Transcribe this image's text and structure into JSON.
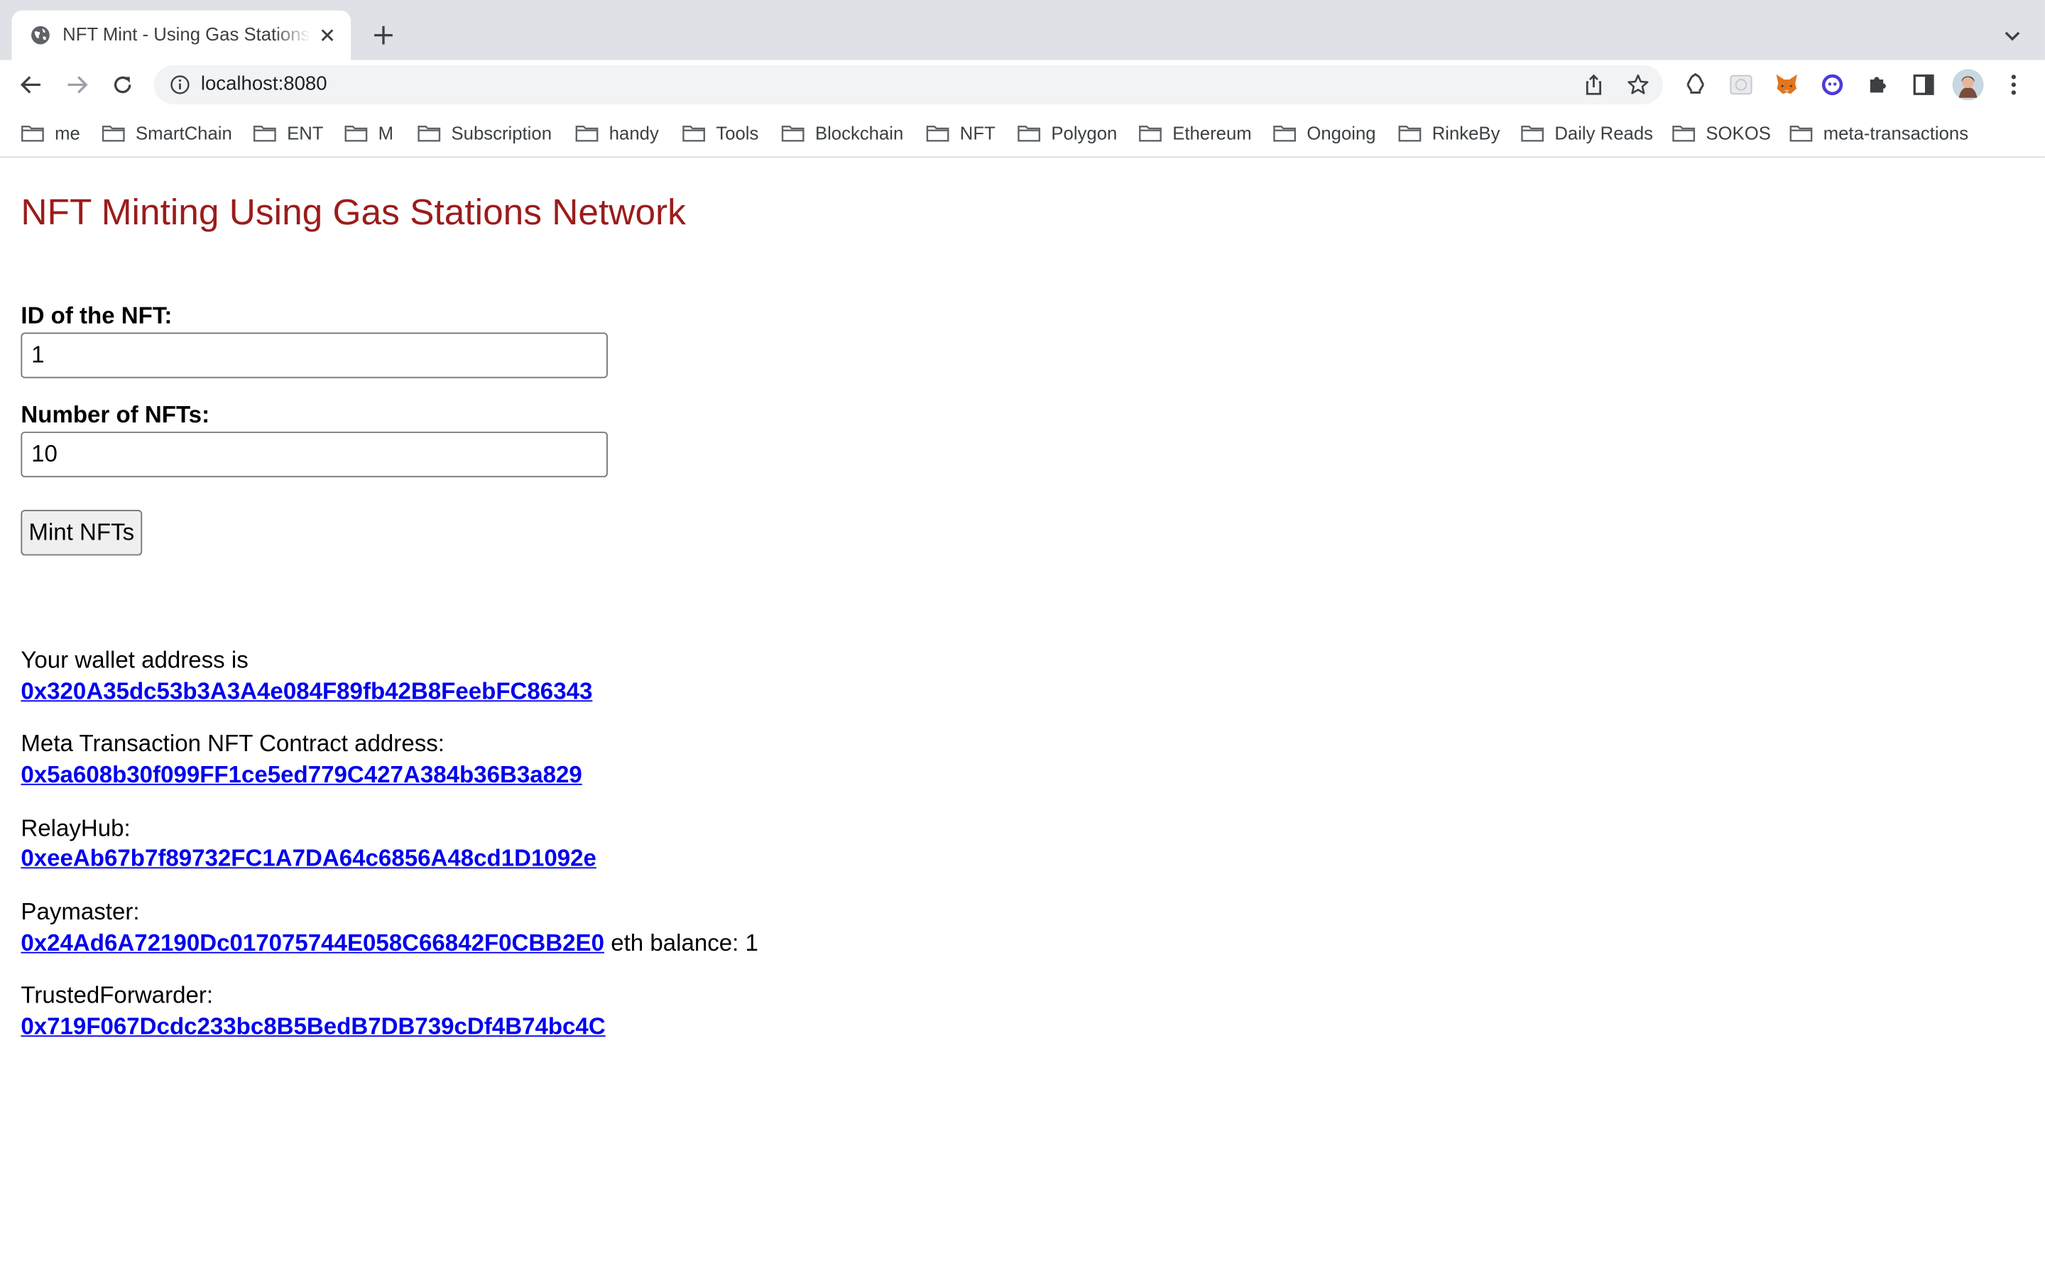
{
  "browser": {
    "tab_title": "NFT Mint - Using Gas Stations Network",
    "url": "localhost:8080",
    "bookmarks": [
      "me",
      "SmartChain",
      "ENT",
      "M",
      "Subscription",
      "handy",
      "Tools",
      "Blockchain",
      "NFT",
      "Polygon",
      "Ethereum",
      "Ongoing",
      "RinkeBy",
      "Daily Reads",
      "SOKOS",
      "meta-transactions"
    ],
    "extensions": [
      "recycle-icon",
      "grid-icon",
      "metamask-fox-icon",
      "ghost-icon",
      "puzzle-icon",
      "side-panel-icon",
      "profile-avatar",
      "more-vert-icon"
    ]
  },
  "page": {
    "title": "NFT Minting Using Gas Stations Network",
    "form": {
      "id_label": "ID of the NFT:",
      "id_value": "1",
      "number_label": "Number of NFTs:",
      "number_value": "10",
      "mint_button": "Mint NFTs"
    },
    "info": {
      "wallet_label": "Your wallet address is",
      "wallet_address": "0x320A35dc53b3A3A4e084F89fb42B8FeebFC86343",
      "contract_label": "Meta Transaction NFT Contract address:",
      "contract_address": "0x5a608b30f099FF1ce5ed779C427A384b36B3a829",
      "relayhub_label": "RelayHub:",
      "relayhub_address": "0xeeAb67b7f89732FC1A7DA64c6856A48cd1D1092e",
      "paymaster_label": "Paymaster:",
      "paymaster_address": "0x24Ad6A72190Dc017075744E058C66842F0CBB2E0",
      "paymaster_balance": "eth balance: 1",
      "forwarder_label": "TrustedForwarder:",
      "forwarder_address": "0x719F067Dcdc233bc8B5BedB7DB739cDf4B74bc4C"
    }
  }
}
